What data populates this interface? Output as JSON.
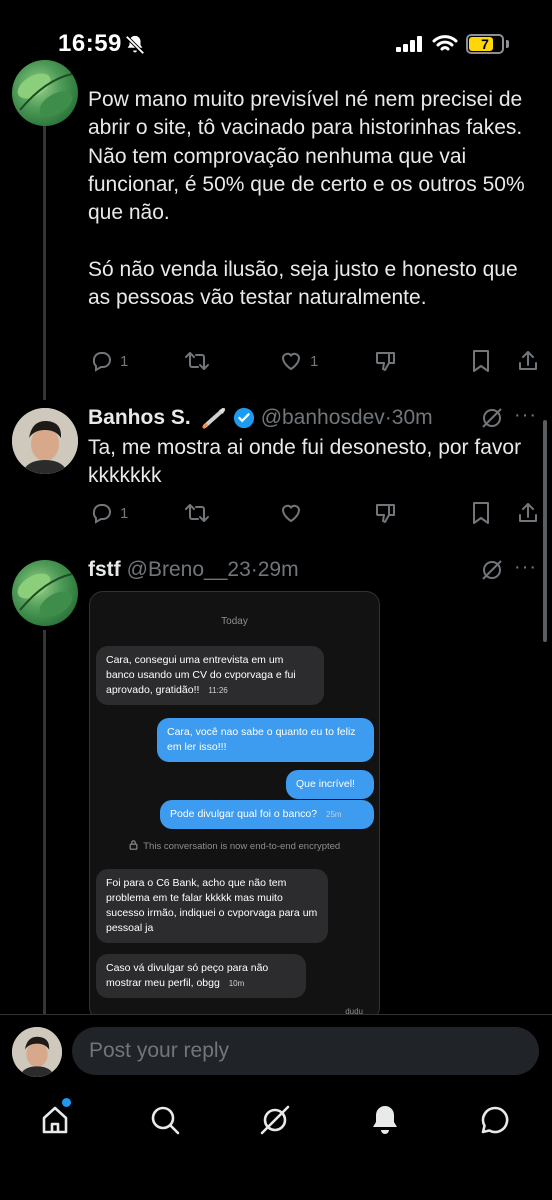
{
  "status_bar": {
    "time": "16:59",
    "battery": "7",
    "battery_color": "#ffd60a"
  },
  "tweets": [
    {
      "text": "Pow mano muito previsível né nem precisei de abrir o site, tô vacinado para historinhas fakes.\nNão tem comprovação nenhuma que vai funcionar, é 50% que de certo e os outros 50% que não.\n\nSó não venda ilusão, seja justo e honesto que as pessoas vão testar naturalmente.",
      "replies": "1",
      "likes": "1"
    },
    {
      "name": "Banhos S.",
      "handle": "@banhosdev",
      "time": "30m",
      "text": "Ta, me mostra ai onde fui desonesto, por favor kkkkkkk",
      "replies": "1"
    },
    {
      "name": "fstf",
      "handle": "@Breno__23",
      "time": "29m"
    }
  ],
  "chat_screenshot": {
    "date": "Today",
    "messages": [
      {
        "text": "Cara, consegui uma entrevista em um banco usando um CV do cvporvaga e fui aprovado, gratidão!!",
        "time": "11:26"
      },
      {
        "text": "Cara, você nao sabe o quanto eu to feliz em ler isso!!!"
      },
      {
        "text": "Que incrível!"
      },
      {
        "text": "Pode divulgar qual foi o banco?",
        "time": "25m"
      },
      {
        "text": "Foi para o C6 Bank, acho que não tem problema em te falar kkkkk mas muito sucesso irmão, indiquei o cvporvaga para um pessoal ja"
      },
      {
        "text": "Caso vá divulgar só peço para não mostrar meu perfil, obgg",
        "time": "10m"
      }
    ],
    "encrypted_notice": "This conversation is now end-to-end encrypted",
    "seen": "dudu"
  },
  "reply": {
    "placeholder": "Post your reply"
  },
  "colors": {
    "accent": "#1d9bf0",
    "verified": "#1d9bf0",
    "outgoing_bubble": "#3d9bf0"
  }
}
